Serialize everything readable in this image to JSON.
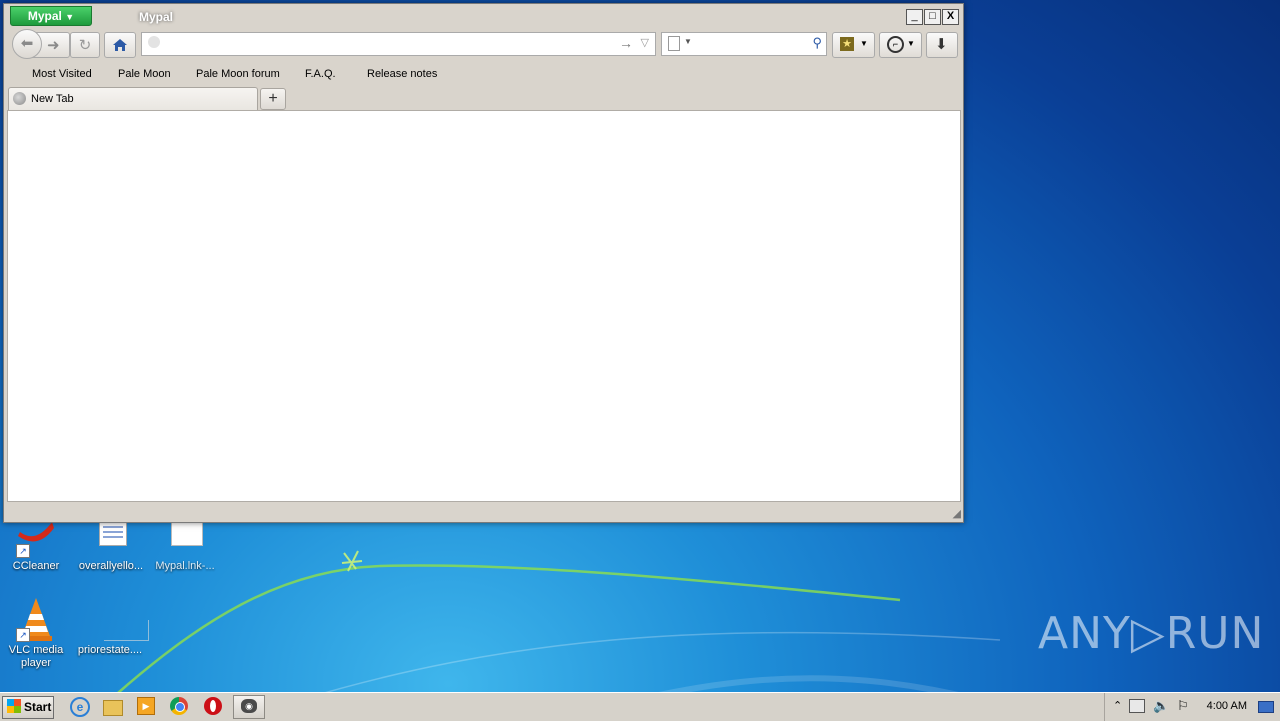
{
  "window": {
    "app_button_label": "Mypal",
    "title": "Mypal",
    "caption": {
      "minimize": "_",
      "maximize": "□",
      "close": "X"
    }
  },
  "navbar": {
    "url_value": "",
    "search_value": ""
  },
  "bookmarks": [
    "Most Visited",
    "Pale Moon",
    "Pale Moon forum",
    "F.A.Q.",
    "Release notes"
  ],
  "tabs": [
    {
      "label": "New Tab"
    }
  ],
  "new_tab_label": "+",
  "desktop_icons": [
    {
      "label": "CCleaner"
    },
    {
      "label": "overallyello..."
    },
    {
      "label": "Mypal.lnk-..."
    },
    {
      "label": "VLC media player"
    },
    {
      "label": "priorestate...."
    }
  ],
  "taskbar": {
    "start_label": "Start",
    "clock": "4:00 AM"
  },
  "watermark": "ANY▷RUN"
}
